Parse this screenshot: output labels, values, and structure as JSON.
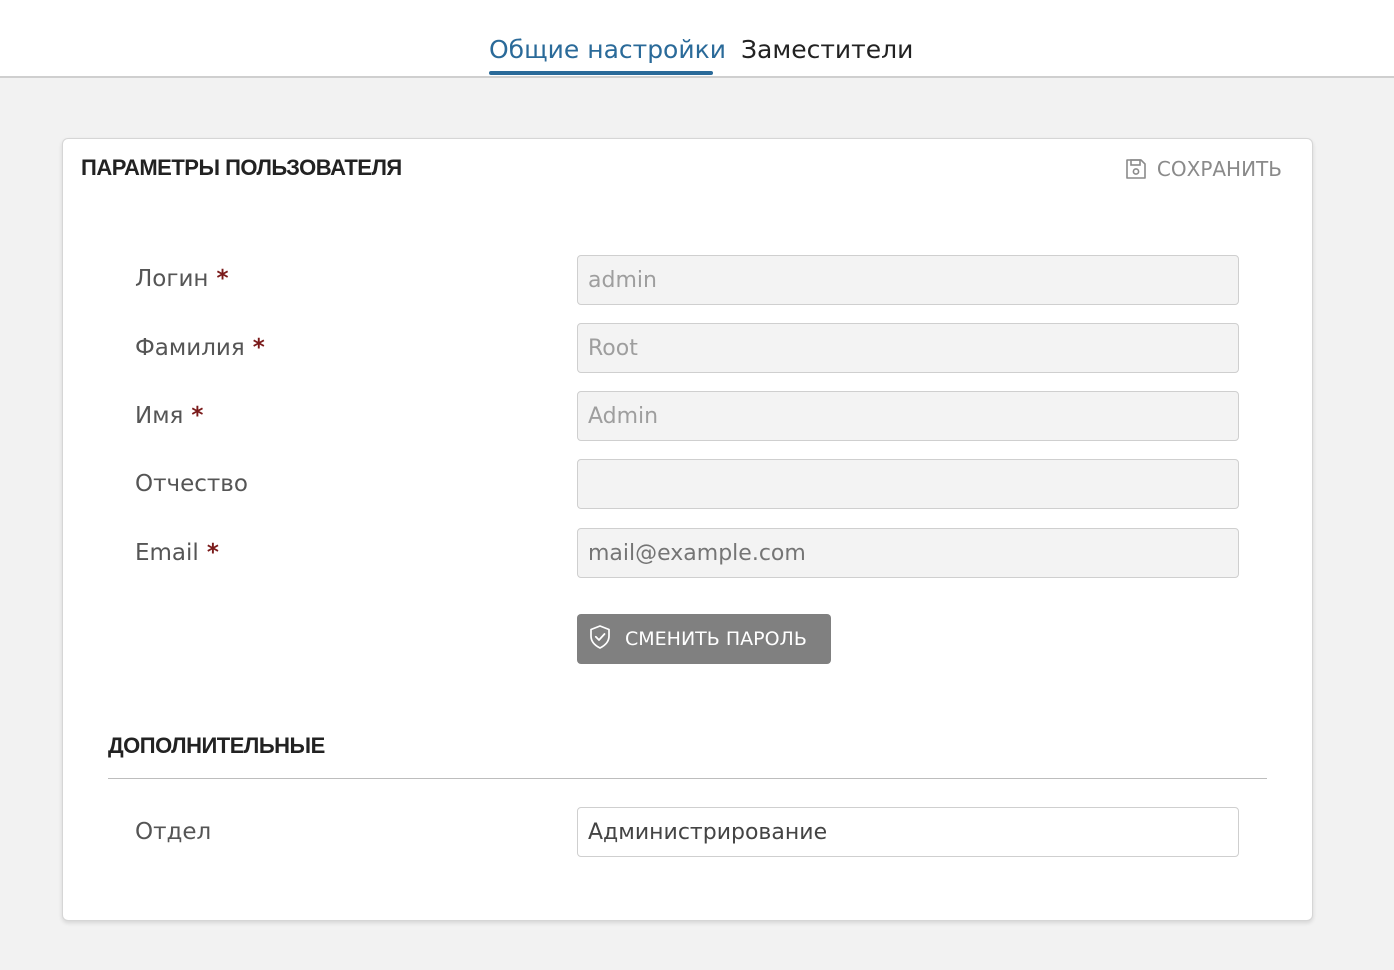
{
  "tabs": [
    {
      "label": "Общие настройки",
      "active": true
    },
    {
      "label": "Заместители",
      "active": false
    }
  ],
  "accent_color": "#2a6a99",
  "card": {
    "title": "ПАРАМЕТРЫ ПОЛЬЗОВАТЕЛЯ",
    "save_label": "СОХРАНИТЬ",
    "save_icon": "save-icon"
  },
  "fields": {
    "login": {
      "label": "Логин",
      "required": "*",
      "value": "admin"
    },
    "lastname": {
      "label": "Фамилия",
      "required": "*",
      "value": "Root"
    },
    "firstname": {
      "label": "Имя",
      "required": "*",
      "value": "Admin"
    },
    "middlename": {
      "label": "Отчество",
      "value": ""
    },
    "email": {
      "label": "Email",
      "required": "*",
      "value": "",
      "placeholder": "mail@example.com"
    }
  },
  "change_password": {
    "label": "СМЕНИТЬ ПАРОЛЬ",
    "icon": "shield-check-icon"
  },
  "additional": {
    "title": "ДОПОЛНИТЕЛЬНЫЕ",
    "department": {
      "label": "Отдел",
      "value": "Администрирование"
    }
  }
}
